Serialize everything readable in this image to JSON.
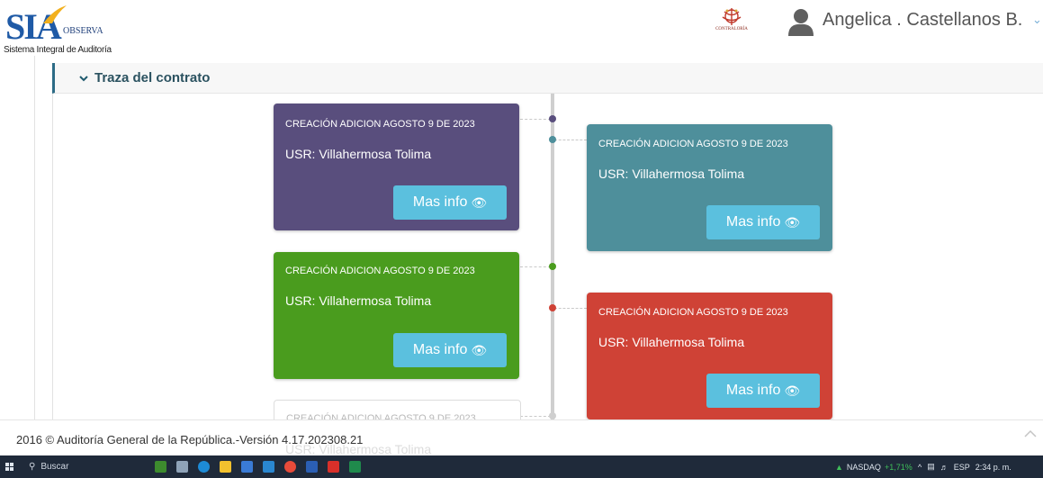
{
  "header": {
    "logo_main": "SIA",
    "logo_secondary": "OBSERVA",
    "logo_subtitle": "Sistema Integral de Auditoría",
    "seal_text": "CONTRALORÍA",
    "user_name": "Angelica . Castellanos B.",
    "user_menu_icon": "chevron-down-icon",
    "avatar_icon": "user-avatar-icon"
  },
  "section": {
    "title": "Traza del contrato",
    "toggle_icon": "chevron-down-icon"
  },
  "timeline": {
    "items": [
      {
        "title": "CREACIÓN ADICION  AGOSTO 9 DE 2023",
        "user": "USR: Villahermosa Tolima",
        "button": "Mas info",
        "color": "#594e7d",
        "side": "left"
      },
      {
        "title": "CREACIÓN ADICION  AGOSTO 9 DE 2023",
        "user": "USR: Villahermosa Tolima",
        "button": "Mas info",
        "color": "#4e8f9b",
        "side": "right"
      },
      {
        "title": "CREACIÓN ADICION  AGOSTO 9 DE 2023",
        "user": "USR: Villahermosa Tolima",
        "button": "Mas info",
        "color": "#4a9c1e",
        "side": "left"
      },
      {
        "title": "CREACIÓN ADICION  AGOSTO 9 DE 2023",
        "user": "USR: Villahermosa Tolima",
        "button": "Mas info",
        "color": "#cf4236",
        "side": "right"
      },
      {
        "title": "CREACIÓN ADICION  AGOSTO 9 DE 2023",
        "user": "USR: Villahermosa Tolima",
        "button": "",
        "color": "#ffffff",
        "side": "left"
      }
    ],
    "button_icon": "eye-icon"
  },
  "footer": {
    "text": "2016 © Auditoría General de la República.-Versión 4.17.202308.21",
    "scroll_top_icon": "chevron-up-icon"
  },
  "taskbar": {
    "search_placeholder": "Buscar",
    "ticker": "NASDAQ",
    "ticker_change": "+1,71%",
    "language": "ESP",
    "time": "2:34 p. m."
  }
}
